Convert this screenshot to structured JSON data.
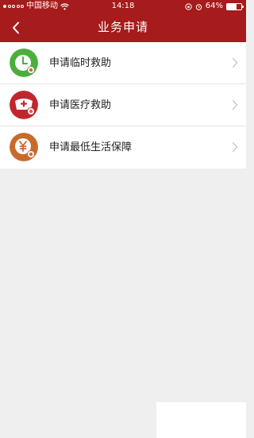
{
  "status_bar": {
    "carrier": "中国移动",
    "time": "14:18",
    "battery_percent": "64%",
    "battery_level": 0.64
  },
  "header": {
    "title": "业务申请",
    "back_icon": "chevron-left-icon"
  },
  "menu": {
    "items": [
      {
        "label": "申请临时救助",
        "icon": "clock-icon",
        "color": "#4caf3c"
      },
      {
        "label": "申请医疗救助",
        "icon": "medical-cap-icon",
        "color": "#c0272d"
      },
      {
        "label": "申请最低生活保障",
        "icon": "yen-coin-icon",
        "color": "#c76a2a"
      }
    ]
  },
  "colors": {
    "brand": "#a61b1b",
    "background": "#efefef"
  }
}
